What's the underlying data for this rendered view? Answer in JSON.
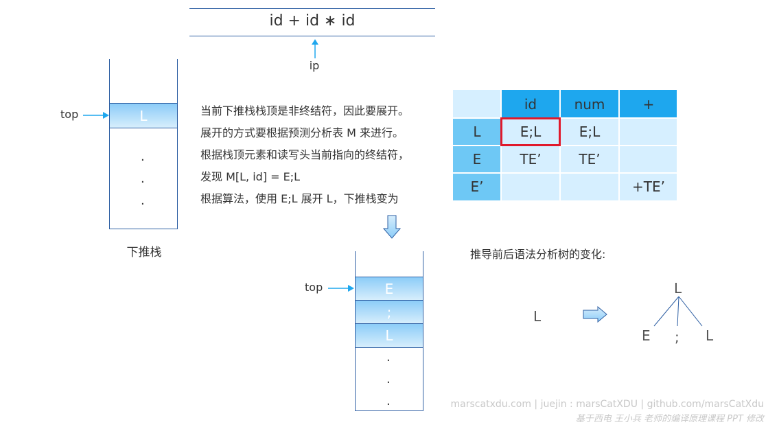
{
  "tape": {
    "text": "id + id ∗ id",
    "pointer_label": "ip"
  },
  "stack_before": {
    "top_label": "top",
    "cells": [
      "L"
    ],
    "dots": [
      ".",
      ".",
      "."
    ],
    "caption": "下推栈"
  },
  "explanation": {
    "lines": [
      "当前下推栈栈顶是非终结符，因此要展开。",
      "展开的方式要根据预测分析表 M 来进行。",
      "根据栈顶元素和读写头当前指向的终结符，",
      "发现 M[L, id] = E;L",
      "根据算法，使用 E;L 展开 L，下推栈变为"
    ]
  },
  "stack_after": {
    "top_label": "top",
    "cells": [
      "E",
      ";",
      "L"
    ],
    "dots": [
      ".",
      ".",
      "."
    ]
  },
  "parse_table": {
    "columns": [
      "id",
      "num",
      "+"
    ],
    "rows": [
      {
        "label": "L",
        "cells": [
          "E;L",
          "E;L",
          ""
        ]
      },
      {
        "label": "E",
        "cells": [
          "TE’",
          "TE’",
          ""
        ]
      },
      {
        "label": "E’",
        "cells": [
          "",
          "",
          "+TE’"
        ]
      }
    ],
    "highlighted": {
      "row": 0,
      "col": 0
    },
    "colors": {
      "header": "#1ea7ee",
      "row_header": "#6ec8f5",
      "cell": "#d6efff",
      "highlight": "#e0192b"
    }
  },
  "tree": {
    "caption": "推导前后语法分析树的变化:",
    "before": "L",
    "after_root": "L",
    "after_children": [
      "E",
      ";",
      "L"
    ]
  },
  "footer": {
    "line1": "marscatxdu.com | juejin : marsCatXDU | github.com/marsCatXdu",
    "line2": "基于西电 王小兵 老师的编译原理课程 PPT 修改"
  }
}
